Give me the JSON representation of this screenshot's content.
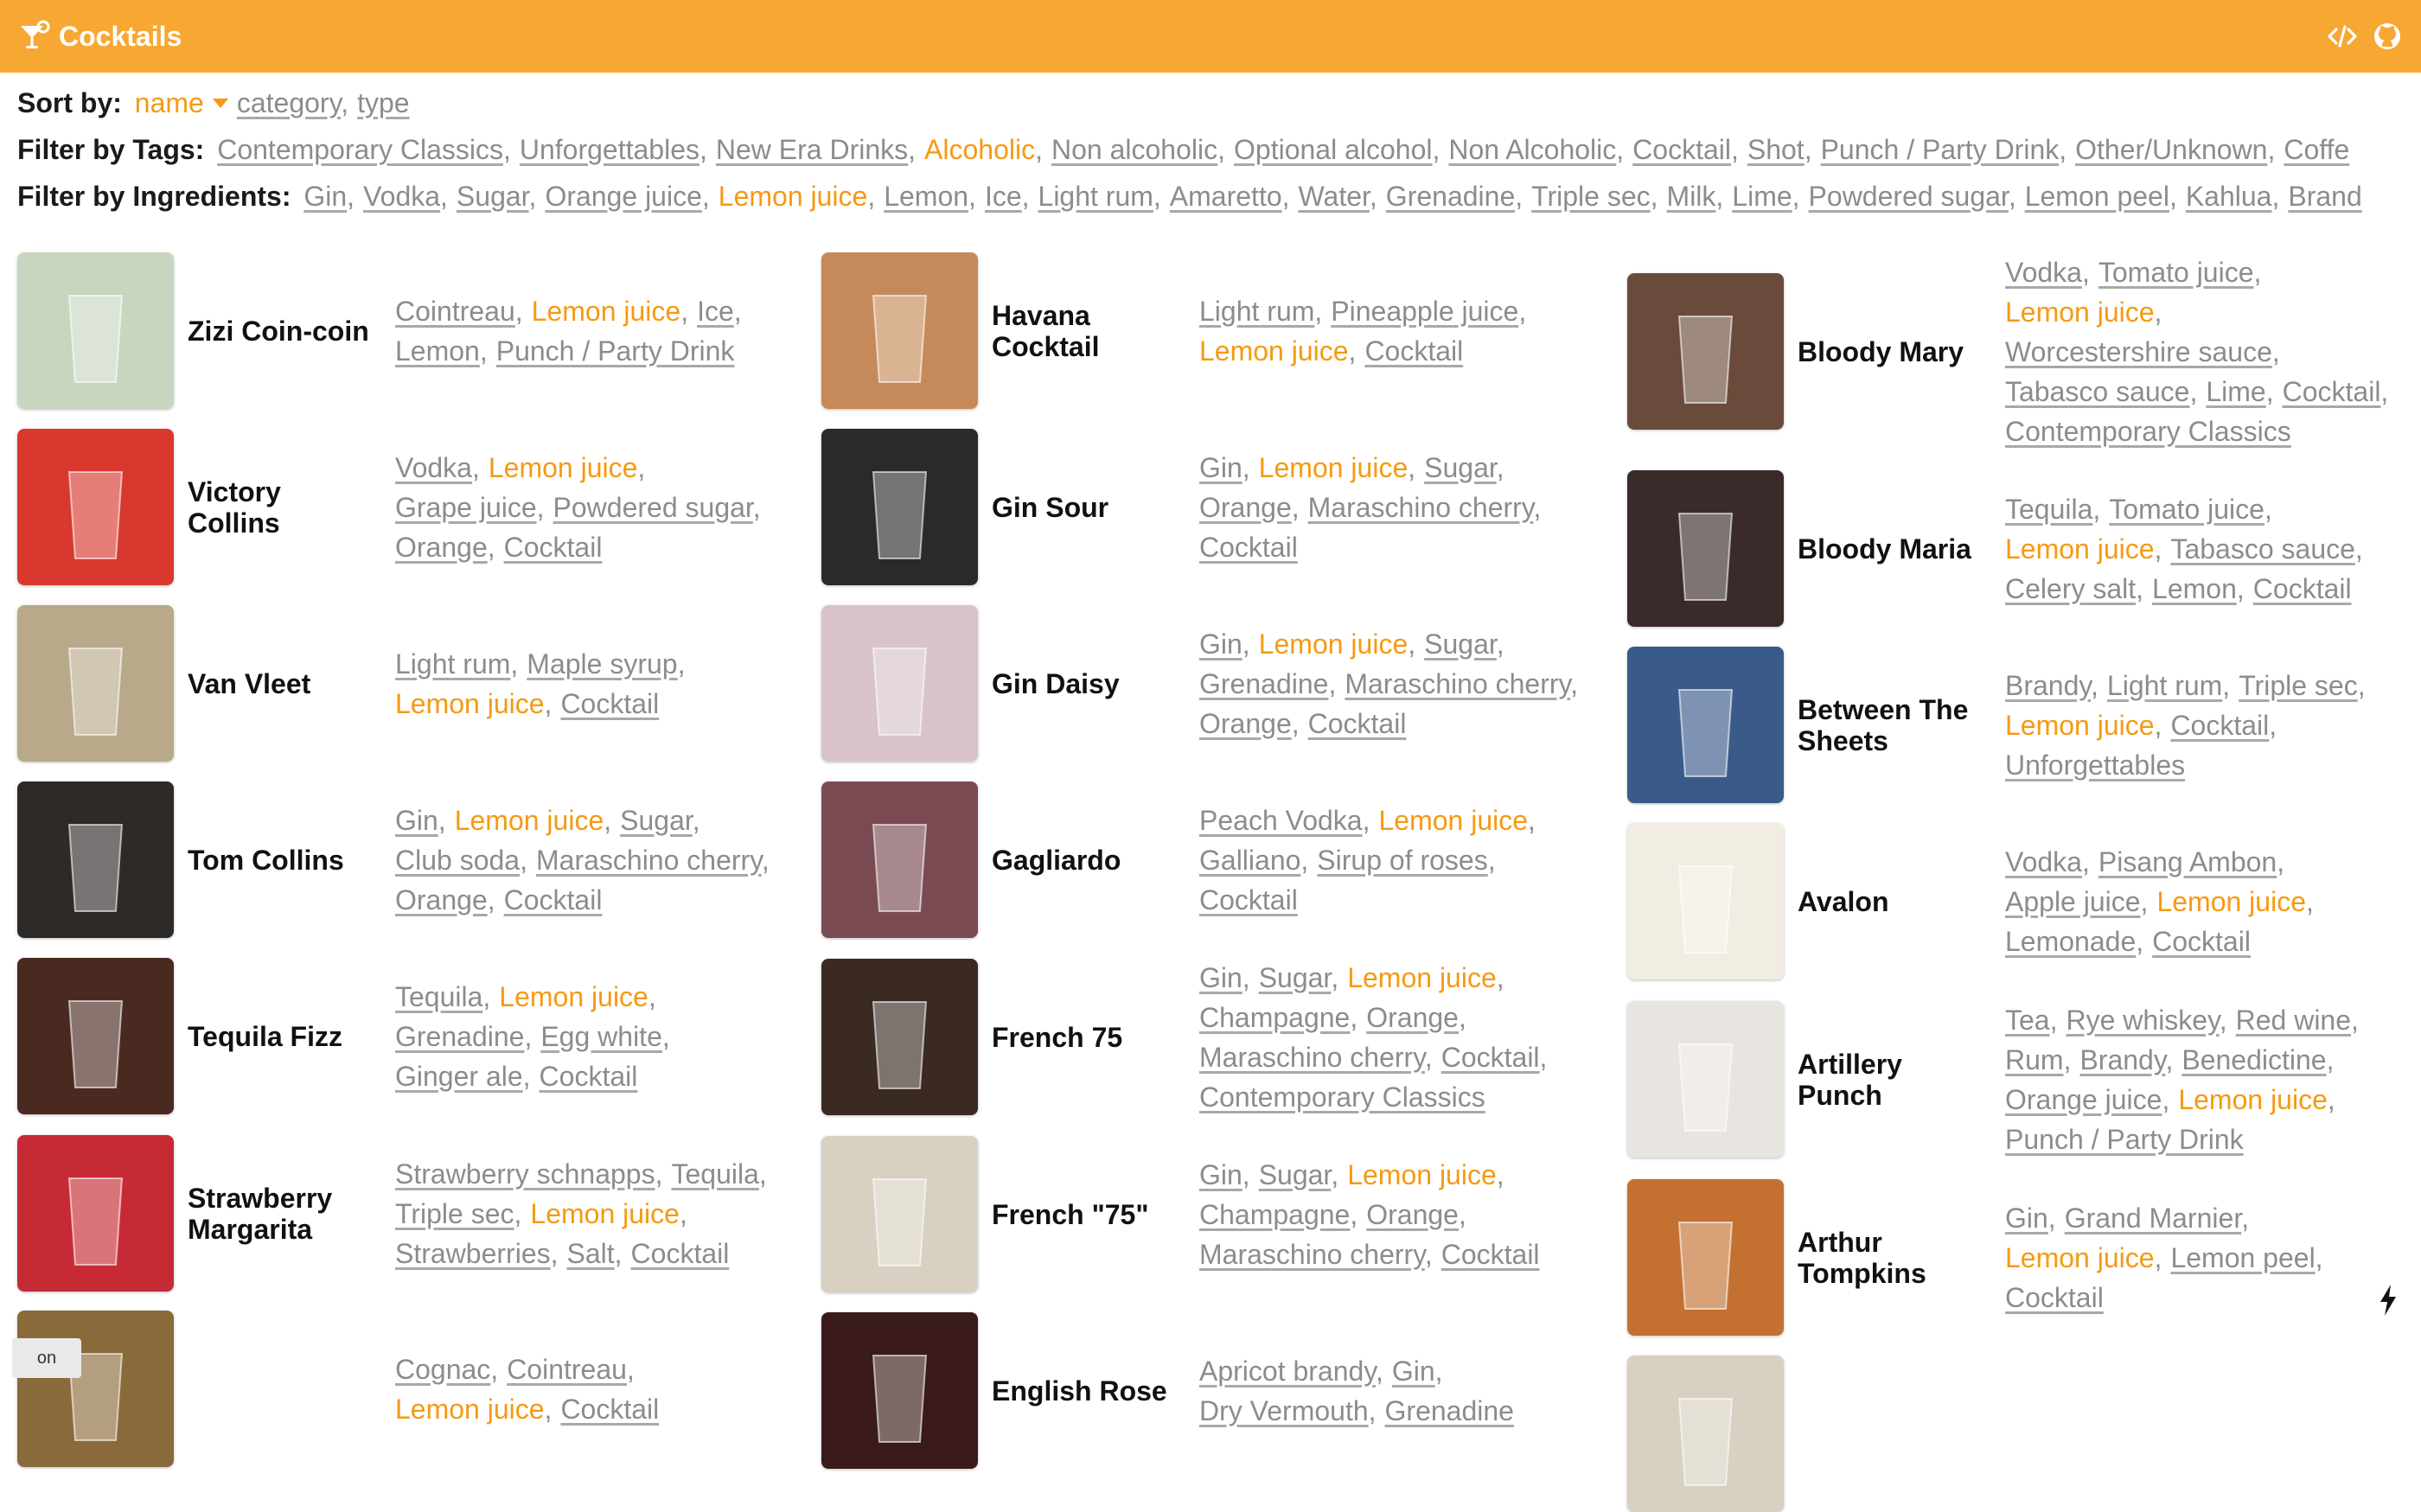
{
  "header": {
    "title": "Cocktails"
  },
  "sort": {
    "label": "Sort by:",
    "options": [
      {
        "text": "name",
        "active": true
      },
      {
        "text": "category",
        "active": false
      },
      {
        "text": "type",
        "active": false
      }
    ]
  },
  "tags_filter": {
    "label": "Filter by Tags:",
    "items": [
      {
        "text": "Contemporary Classics",
        "active": false
      },
      {
        "text": "Unforgettables",
        "active": false
      },
      {
        "text": "New Era Drinks",
        "active": false
      },
      {
        "text": "Alcoholic",
        "active": true
      },
      {
        "text": "Non alcoholic",
        "active": false
      },
      {
        "text": "Optional alcohol",
        "active": false
      },
      {
        "text": "Non Alcoholic",
        "active": false
      },
      {
        "text": "Cocktail",
        "active": false
      },
      {
        "text": "Shot",
        "active": false
      },
      {
        "text": "Punch / Party Drink",
        "active": false
      },
      {
        "text": "Other/Unknown",
        "active": false
      },
      {
        "text": "Coffe",
        "active": false
      }
    ]
  },
  "ingredients_filter": {
    "label": "Filter by Ingredients:",
    "items": [
      {
        "text": "Gin",
        "active": false
      },
      {
        "text": "Vodka",
        "active": false
      },
      {
        "text": "Sugar",
        "active": false
      },
      {
        "text": "Orange juice",
        "active": false
      },
      {
        "text": "Lemon juice",
        "active": true
      },
      {
        "text": "Lemon",
        "active": false
      },
      {
        "text": "Ice",
        "active": false
      },
      {
        "text": "Light rum",
        "active": false
      },
      {
        "text": "Amaretto",
        "active": false
      },
      {
        "text": "Water",
        "active": false
      },
      {
        "text": "Grenadine",
        "active": false
      },
      {
        "text": "Triple sec",
        "active": false
      },
      {
        "text": "Milk",
        "active": false
      },
      {
        "text": "Lime",
        "active": false
      },
      {
        "text": "Powdered sugar",
        "active": false
      },
      {
        "text": "Lemon peel",
        "active": false
      },
      {
        "text": "Kahlua",
        "active": false
      },
      {
        "text": "Brand",
        "active": false
      }
    ]
  },
  "columns": [
    [
      {
        "name": "Zizi Coin-coin",
        "tags": [
          "Cointreau",
          "Lemon juice",
          "Ice",
          "Lemon",
          "Punch / Party Drink"
        ],
        "lines": [
          3,
          2
        ],
        "img": "#c8d6c0"
      },
      {
        "name": "Victory Collins",
        "tags": [
          "Vodka",
          "Lemon juice",
          "Grape juice",
          "Powdered sugar",
          "Orange",
          "Cocktail"
        ],
        "lines": [
          2,
          2,
          2
        ],
        "img": "#d9382f"
      },
      {
        "name": "Van Vleet",
        "tags": [
          "Light rum",
          "Maple syrup",
          "Lemon juice",
          "Cocktail"
        ],
        "lines": [
          2,
          2
        ],
        "img": "#b8a98a"
      },
      {
        "name": "Tom Collins",
        "tags": [
          "Gin",
          "Lemon juice",
          "Sugar",
          "Club soda",
          "Maraschino cherry",
          "Orange",
          "Cocktail"
        ],
        "lines": [
          3,
          2,
          2
        ],
        "img": "#2e2a28"
      },
      {
        "name": "Tequila Fizz",
        "tags": [
          "Tequila",
          "Lemon juice",
          "Grenadine",
          "Egg white",
          "Ginger ale",
          "Cocktail"
        ],
        "lines": [
          2,
          2,
          2
        ],
        "img": "#4a2a20"
      },
      {
        "name": "Strawberry Margarita",
        "tags": [
          "Strawberry schnapps",
          "Tequila",
          "Triple sec",
          "Lemon juice",
          "Strawberries",
          "Salt",
          "Cocktail"
        ],
        "lines": [
          2,
          2,
          3
        ],
        "img": "#c62a35"
      },
      {
        "name": "",
        "tags": [
          "Cognac",
          "Cointreau",
          "Lemon juice",
          "Cocktail"
        ],
        "lines": [
          2,
          2
        ],
        "img": "#8a6a3a"
      }
    ],
    [
      {
        "name": "Havana Cocktail",
        "tags": [
          "Light rum",
          "Pineapple juice",
          "Lemon juice",
          "Cocktail"
        ],
        "lines": [
          2,
          2
        ],
        "img": "#c68a5a"
      },
      {
        "name": "Gin Sour",
        "tags": [
          "Gin",
          "Lemon juice",
          "Sugar",
          "Orange",
          "Maraschino cherry",
          "Cocktail"
        ],
        "lines": [
          3,
          2,
          1
        ],
        "img": "#2a2a2a"
      },
      {
        "name": "Gin Daisy",
        "tags": [
          "Gin",
          "Lemon juice",
          "Sugar",
          "Grenadine",
          "Maraschino cherry",
          "Orange",
          "Cocktail"
        ],
        "lines": [
          3,
          2,
          2
        ],
        "img": "#d8c4c8"
      },
      {
        "name": "Gagliardo",
        "tags": [
          "Peach Vodka",
          "Lemon juice",
          "Galliano",
          "Sirup of roses",
          "Cocktail"
        ],
        "lines": [
          2,
          2,
          1
        ],
        "img": "#7a4a52"
      },
      {
        "name": "French 75",
        "tags": [
          "Gin",
          "Sugar",
          "Lemon juice",
          "Champagne",
          "Orange",
          "Maraschino cherry",
          "Cocktail",
          "Contemporary Classics"
        ],
        "lines": [
          3,
          2,
          2,
          1
        ],
        "img": "#3a2a22"
      },
      {
        "name": "French \"75\"",
        "tags": [
          "Gin",
          "Sugar",
          "Lemon juice",
          "Champagne",
          "Orange",
          "Maraschino cherry",
          "Cocktail"
        ],
        "lines": [
          3,
          2,
          2
        ],
        "img": "#d8d0c0"
      },
      {
        "name": "English Rose",
        "tags": [
          "Apricot brandy",
          "Gin",
          "Dry Vermouth",
          "Grenadine"
        ],
        "lines": [
          2,
          2
        ],
        "img": "#3a1a1a"
      }
    ],
    [
      {
        "name": "Bloody Mary",
        "tags": [
          "Vodka",
          "Tomato juice",
          "Lemon juice",
          "Worcestershire sauce",
          "Tabasco sauce",
          "Lime",
          "Cocktail",
          "Contemporary Classics"
        ],
        "lines": [
          2,
          1,
          1,
          3,
          1
        ],
        "img": "#6a4a3a"
      },
      {
        "name": "Bloody Maria",
        "tags": [
          "Tequila",
          "Tomato juice",
          "Lemon juice",
          "Tabasco sauce",
          "Celery salt",
          "Lemon",
          "Cocktail"
        ],
        "lines": [
          2,
          2,
          3
        ],
        "img": "#3a2a2a"
      },
      {
        "name": "Between The Sheets",
        "tags": [
          "Brandy",
          "Light rum",
          "Triple sec",
          "Lemon juice",
          "Cocktail",
          "Unforgettables"
        ],
        "lines": [
          3,
          2,
          1
        ],
        "img": "#3a5a8a"
      },
      {
        "name": "Avalon",
        "tags": [
          "Vodka",
          "Pisang Ambon",
          "Apple juice",
          "Lemon juice",
          "Lemonade",
          "Cocktail"
        ],
        "lines": [
          2,
          2,
          2
        ],
        "img": "#f2ede2"
      },
      {
        "name": "Artillery Punch",
        "tags": [
          "Tea",
          "Rye whiskey",
          "Red wine",
          "Rum",
          "Brandy",
          "Benedictine",
          "Orange juice",
          "Lemon juice",
          "Punch / Party Drink"
        ],
        "lines": [
          3,
          3,
          2,
          1
        ],
        "img": "#e8e4e0"
      },
      {
        "name": "Arthur Tompkins",
        "tags": [
          "Gin",
          "Grand Marnier",
          "Lemon juice",
          "Lemon peel",
          "Cocktail"
        ],
        "lines": [
          2,
          2,
          1
        ],
        "img": "#c47030"
      },
      {
        "name": "",
        "tags": [],
        "lines": [],
        "img": "#d8d0c0"
      }
    ]
  ],
  "footer": {
    "badge_text": "on"
  },
  "colors": {
    "accent": "#f7a833",
    "active": "#f59a12",
    "muted": "#8c8c8c"
  }
}
